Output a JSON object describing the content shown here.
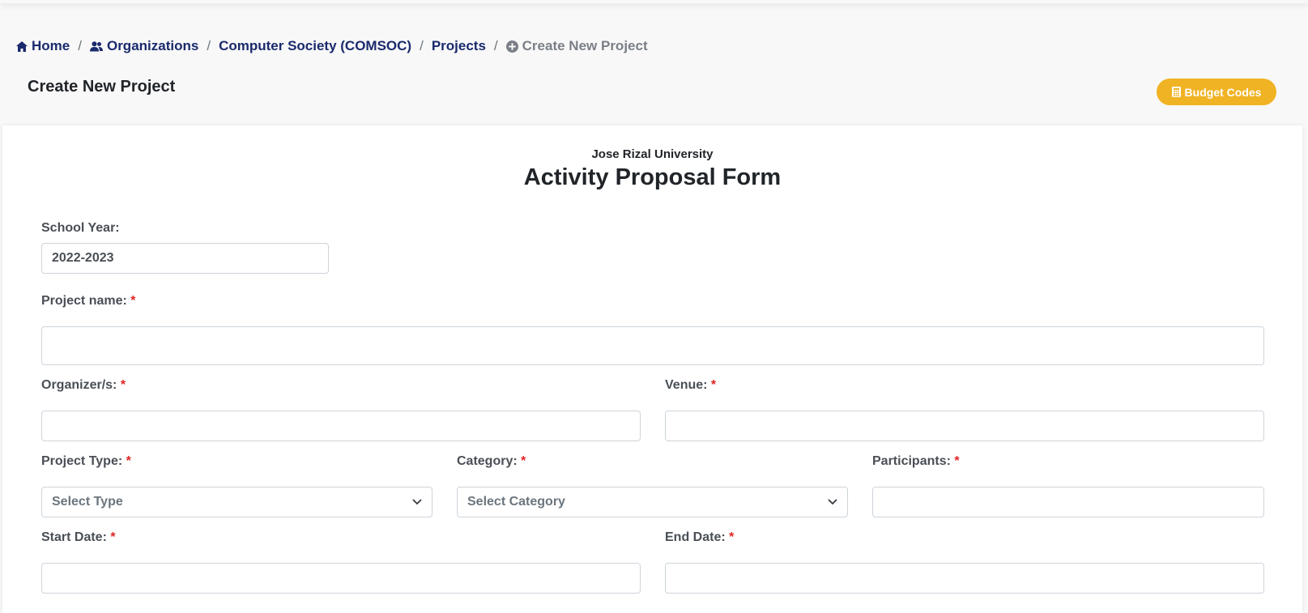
{
  "breadcrumb": {
    "home": "Home",
    "organizations": "Organizations",
    "org": "Computer Society (COMSOC)",
    "projects": "Projects",
    "current": "Create New Project",
    "separator": "/"
  },
  "page": {
    "title": "Create New Project",
    "budget_button": "Budget Codes"
  },
  "form": {
    "university": "Jose Rizal University",
    "title": "Activity Proposal Form",
    "required_mark": "*",
    "school_year": {
      "label": "School Year:",
      "value": "2022-2023"
    },
    "project_name": {
      "label": "Project name:",
      "value": ""
    },
    "organizers": {
      "label": "Organizer/s:",
      "value": ""
    },
    "venue": {
      "label": "Venue:",
      "value": ""
    },
    "project_type": {
      "label": "Project Type:",
      "selected": "Select Type"
    },
    "category": {
      "label": "Category:",
      "selected": "Select Category"
    },
    "participants": {
      "label": "Participants:",
      "value": ""
    },
    "start_date": {
      "label": "Start Date:",
      "value": ""
    },
    "end_date": {
      "label": "End Date:",
      "value": ""
    }
  },
  "colors": {
    "link": "#1a2a6c",
    "accent": "#f0b323",
    "required": "#e02424"
  },
  "icons": {
    "home": "home-icon",
    "organizations": "users-icon",
    "create": "plus-circle-icon",
    "budget": "calculator-icon",
    "dropdown": "chevron-down-icon"
  }
}
